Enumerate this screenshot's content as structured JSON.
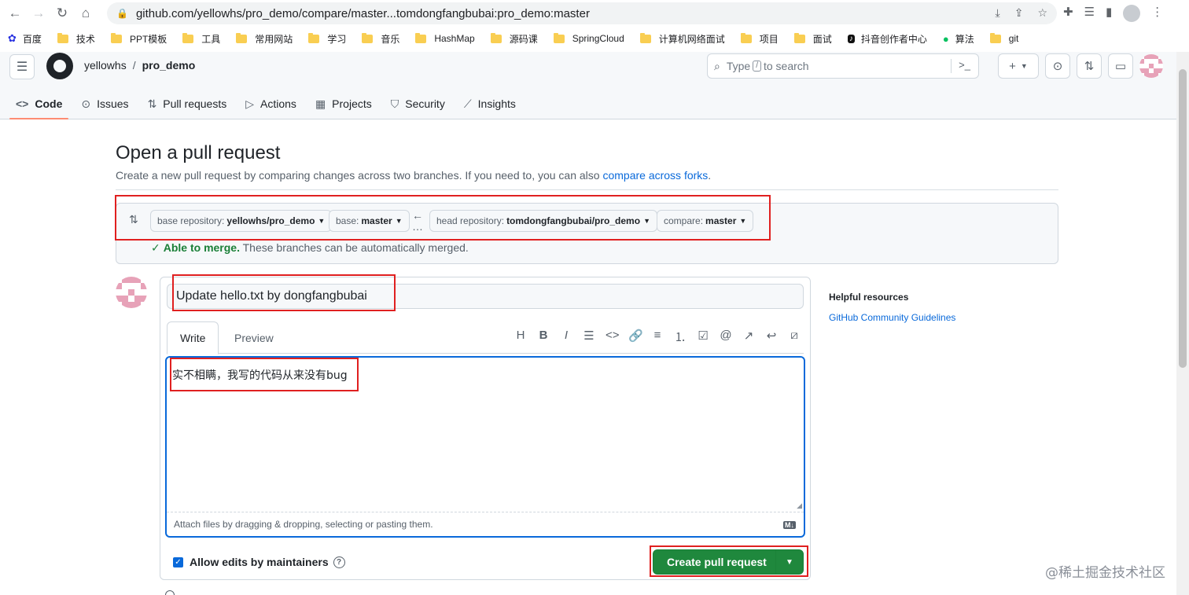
{
  "browser": {
    "url": "github.com/yellowhs/pro_demo/compare/master...tomdongfangbubai:pro_demo:master",
    "bookmarks": [
      "百度",
      "技术",
      "PPT模板",
      "工具",
      "常用网站",
      "学习",
      "音乐",
      "HashMap",
      "源码课",
      "SpringCloud",
      "计算机网络面试",
      "项目",
      "面试",
      "抖音创作者中心",
      "算法",
      "git"
    ]
  },
  "header": {
    "owner": "yellowhs",
    "separator": "/",
    "repo": "pro_demo",
    "search_prefix": "Type",
    "search_key": "/",
    "search_suffix": "to search"
  },
  "tabs": [
    {
      "label": "Code",
      "icon": "code-icon",
      "glyph": "<>"
    },
    {
      "label": "Issues",
      "icon": "issue-icon",
      "glyph": "⊙"
    },
    {
      "label": "Pull requests",
      "icon": "pull-request-icon",
      "glyph": "⇅"
    },
    {
      "label": "Actions",
      "icon": "play-icon",
      "glyph": "▷"
    },
    {
      "label": "Projects",
      "icon": "table-icon",
      "glyph": "▦"
    },
    {
      "label": "Security",
      "icon": "shield-icon",
      "glyph": "⛉"
    },
    {
      "label": "Insights",
      "icon": "graph-icon",
      "glyph": "⟋"
    }
  ],
  "main": {
    "title": "Open a pull request",
    "subtitle": "Create a new pull request by comparing changes across two branches. If you need to, you can also",
    "subtitle_link": "compare across forks",
    "subtitle_end": "."
  },
  "compare": {
    "base_repo_label": "base repository:",
    "base_repo": "yellowhs/pro_demo",
    "base_label": "base:",
    "base": "master",
    "head_repo_label": "head repository:",
    "head_repo": "tomdongfangbubai/pro_demo",
    "compare_label": "compare:",
    "compare": "master",
    "merge_status": "Able to merge.",
    "merge_detail": "These branches can be automatically merged."
  },
  "form": {
    "title_value": "Update hello.txt by dongfangbubai",
    "tab_write": "Write",
    "tab_preview": "Preview",
    "body_value": "实不相瞒，我写的代码从来没有bug",
    "attach_hint": "Attach files by dragging & dropping, selecting or pasting them.",
    "allow_edits": "Allow edits by maintainers",
    "submit": "Create pull request"
  },
  "sidebar": {
    "heading": "Helpful resources",
    "link": "GitHub Community Guidelines"
  },
  "watermark": "@稀土掘金技术社区",
  "colors": {
    "accent": "#0969da",
    "success": "#1f883d",
    "annotation": "#e02020",
    "tab_underline": "#fd8c73"
  }
}
